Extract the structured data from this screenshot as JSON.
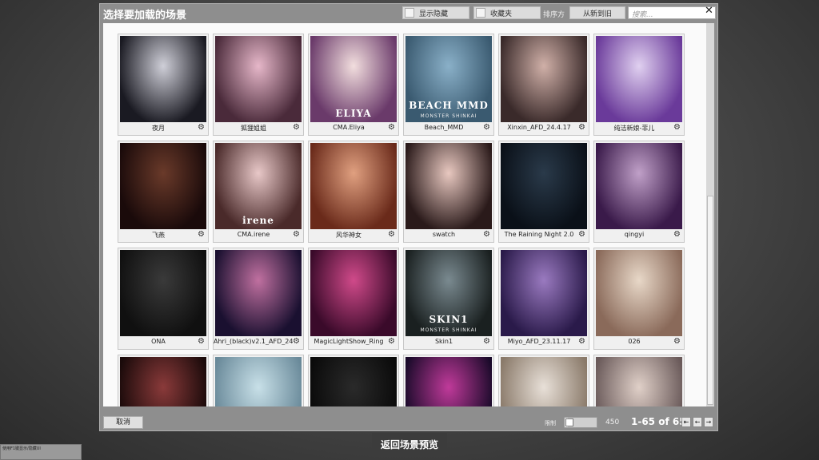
{
  "dialog": {
    "title": "选择要加载的场景",
    "show_hidden_label": "显示隐藏",
    "favorites_label": "收藏夹",
    "sort_label": "排序方",
    "sort_value": "从新到旧",
    "search_placeholder": "搜索...",
    "close_glyph": "✕"
  },
  "scenes": [
    {
      "label": "夜月",
      "colors": [
        "#cfcfd8",
        "#1a1a22"
      ]
    },
    {
      "label": "狐狸姐姐",
      "colors": [
        "#e6b7c9",
        "#4a2a3a"
      ]
    },
    {
      "label": "CMA.Eliya",
      "colors": [
        "#f2dede",
        "#6a3a6a"
      ],
      "overlay": "ELIYA"
    },
    {
      "label": "Beach_MMD",
      "colors": [
        "#8ab0c8",
        "#3a5a70"
      ],
      "overlay": "BEACH MMD",
      "overlay2": "MONSTER SHINKAI"
    },
    {
      "label": "Xinxin_AFD_24.4.17",
      "colors": [
        "#d0b0a8",
        "#3a2a2a"
      ]
    },
    {
      "label": "纯洁新娘-菲儿",
      "colors": [
        "#e0d0f0",
        "#6a3a9a"
      ]
    },
    {
      "label": "飞燕",
      "colors": [
        "#6a3a2a",
        "#1a0a0a"
      ]
    },
    {
      "label": "CMA.irene",
      "colors": [
        "#e8c8c8",
        "#4a2a2a"
      ],
      "overlay": "irene"
    },
    {
      "label": "风华神女",
      "colors": [
        "#e0a080",
        "#6a2a1a"
      ]
    },
    {
      "label": "swatch",
      "colors": [
        "#e8c8c0",
        "#2a1a1a"
      ]
    },
    {
      "label": "The Raining Night 2.0",
      "colors": [
        "#2a3a4a",
        "#0a1018"
      ]
    },
    {
      "label": "qingyi",
      "colors": [
        "#c0a0c8",
        "#3a1a4a"
      ]
    },
    {
      "label": "ONA",
      "colors": [
        "#3a3a3a",
        "#101010"
      ]
    },
    {
      "label": "Ahri_(black)v2.1_AFD_24.1.26",
      "colors": [
        "#c070a0",
        "#1a1030"
      ]
    },
    {
      "label": "MagicLightShow_Ring",
      "colors": [
        "#d04a8a",
        "#3a0a2a"
      ]
    },
    {
      "label": "Skin1",
      "colors": [
        "#7a8a90",
        "#1a2020"
      ],
      "overlay": "SKIN1",
      "overlay2": "MONSTER SHINKAI"
    },
    {
      "label": "Miyo_AFD_23.11.17",
      "colors": [
        "#9a7ac0",
        "#2a1a4a"
      ]
    },
    {
      "label": "026",
      "colors": [
        "#e8d8c8",
        "#8a6a5a"
      ]
    },
    {
      "label": "",
      "colors": [
        "#8a3a3a",
        "#1a0a0a"
      ]
    },
    {
      "label": "",
      "colors": [
        "#c8e0e8",
        "#6a8a9a"
      ]
    },
    {
      "label": "",
      "colors": [
        "#2a2a2a",
        "#0a0a0a"
      ]
    },
    {
      "label": "",
      "colors": [
        "#c03a9a",
        "#1a0a2a"
      ]
    },
    {
      "label": "",
      "colors": [
        "#e8e0d8",
        "#8a7a6a"
      ]
    },
    {
      "label": "",
      "colors": [
        "#e0d0c8",
        "#6a5a5a"
      ]
    }
  ],
  "footer": {
    "cancel_label": "取消",
    "limit_label": "限制",
    "limit_value": "450",
    "slider_level": 0.1,
    "page_info": "1-65 of 65",
    "first_glyph": "⇤",
    "prev_glyph": "←",
    "next_glyph": "→"
  },
  "bottom": {
    "back_preview_label": "返回场景预览",
    "corner_text": "使用F1键显示/隐藏UI"
  },
  "icons": {
    "gear": "gear-icon"
  }
}
